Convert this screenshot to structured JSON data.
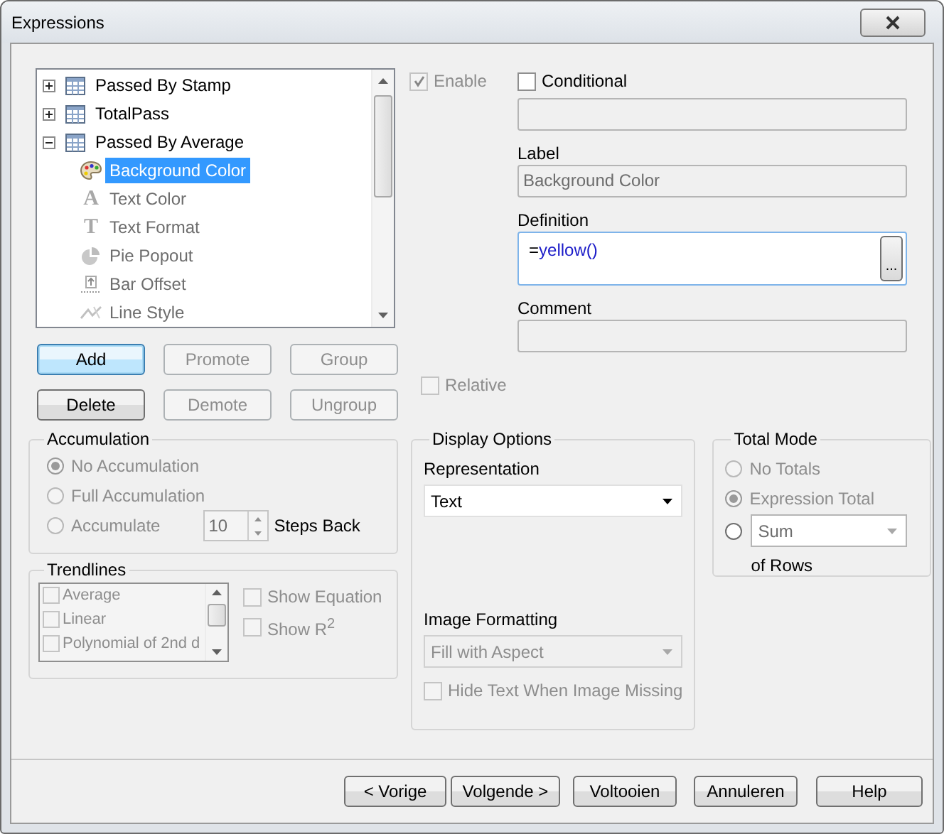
{
  "window": {
    "title": "Expressions"
  },
  "tree": [
    {
      "label": "Passed By Stamp",
      "expanded": false
    },
    {
      "label": "TotalPass",
      "expanded": false
    },
    {
      "label": "Passed By Average",
      "expanded": true,
      "children": [
        {
          "label": "Background Color",
          "kind": "palette",
          "selected": true,
          "disabled": false
        },
        {
          "label": "Text Color",
          "kind": "glyph",
          "glyph": "A",
          "selected": false,
          "disabled": true
        },
        {
          "label": "Text Format",
          "kind": "glyph",
          "glyph": "T",
          "selected": false,
          "disabled": true
        },
        {
          "label": "Pie Popout",
          "kind": "pie",
          "selected": false,
          "disabled": true
        },
        {
          "label": "Bar Offset",
          "kind": "bar-offset",
          "selected": false,
          "disabled": true
        },
        {
          "label": "Line Style",
          "kind": "line-style",
          "selected": false,
          "disabled": true
        }
      ]
    }
  ],
  "tree_buttons": [
    {
      "label": "Add",
      "disabled": false,
      "default": true
    },
    {
      "label": "Promote",
      "disabled": true,
      "default": false
    },
    {
      "label": "Group",
      "disabled": true,
      "default": false
    },
    {
      "label": "Delete",
      "disabled": false,
      "default": false
    },
    {
      "label": "Demote",
      "disabled": true,
      "default": false
    },
    {
      "label": "Ungroup",
      "disabled": true,
      "default": false
    }
  ],
  "enable": {
    "label": "Enable",
    "checked": true,
    "disabled": true
  },
  "conditional": {
    "label": "Conditional",
    "checked": false,
    "disabled": false
  },
  "conditional_field": {
    "disabled": true
  },
  "label_field": {
    "caption": "Label",
    "value": "Background Color",
    "disabled": true
  },
  "definition": {
    "caption": "Definition",
    "prefix": "=",
    "expression": "yellow()",
    "button": "..."
  },
  "comment": {
    "caption": "Comment",
    "disabled": true
  },
  "relative": {
    "label": "Relative",
    "checked": false,
    "disabled": true
  },
  "accumulation": {
    "title": "Accumulation",
    "disabled": true,
    "options": [
      {
        "label": "No Accumulation",
        "selected": true
      },
      {
        "label": "Full Accumulation",
        "selected": false
      },
      {
        "label": "Accumulate",
        "selected": false
      }
    ],
    "steps": {
      "value": "10",
      "label": "Steps Back"
    }
  },
  "trendlines": {
    "title": "Trendlines",
    "disabled": true,
    "items": [
      {
        "label": "Average",
        "checked": false
      },
      {
        "label": "Linear",
        "checked": false
      },
      {
        "label": "Polynomial of 2nd d",
        "checked": false
      }
    ],
    "options": [
      {
        "label": "Show Equation",
        "checked": false
      },
      {
        "label": "Show R$^{2}$",
        "checked": false
      }
    ]
  },
  "display_options": {
    "title": "Display Options",
    "representation": {
      "caption": "Representation",
      "value": "Text",
      "disabled": false
    },
    "image_formatting": {
      "caption": "Image Formatting",
      "value": "Fill with Aspect",
      "disabled": true
    },
    "hide_text": {
      "label": "Hide Text When Image Missing",
      "checked": false,
      "disabled": true
    }
  },
  "total_mode": {
    "title": "Total Mode",
    "options": [
      {
        "kind": "label",
        "label": "No Totals",
        "selected": false,
        "disabled": true
      },
      {
        "kind": "label",
        "label": "Expression Total",
        "selected": true,
        "disabled": true
      },
      {
        "kind": "aggregate",
        "value": "Sum",
        "suffix": "of Rows",
        "selected": false,
        "disabled": false
      }
    ]
  },
  "footer_buttons": [
    {
      "label": "< Vorige"
    },
    {
      "label": "Volgende >"
    },
    {
      "label": "Voltooien"
    },
    {
      "label": "Annuleren"
    },
    {
      "label": "Help"
    }
  ]
}
